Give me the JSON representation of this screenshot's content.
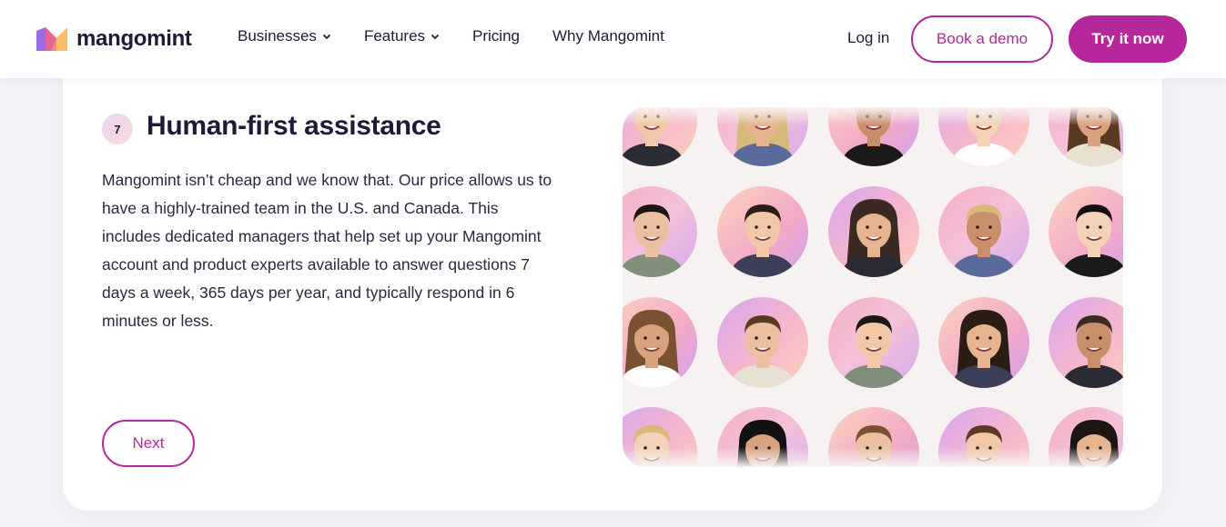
{
  "brand": {
    "name": "mangomint",
    "logo_icon": "mangomint-logo-icon",
    "accent_color": "#b5279a"
  },
  "nav": {
    "items": [
      {
        "label": "Businesses",
        "has_dropdown": true
      },
      {
        "label": "Features",
        "has_dropdown": true
      },
      {
        "label": "Pricing",
        "has_dropdown": false
      },
      {
        "label": "Why Mangomint",
        "has_dropdown": false
      }
    ],
    "login": "Log in",
    "demo": "Book a demo",
    "try": "Try it now"
  },
  "section": {
    "step": "7",
    "title": "Human-first assistance",
    "description": "Mangomint isn’t cheap and we know that. Our price allows us to have a highly-trained team in the U.S. and Canada. This includes dedicated managers that help set up your Mangomint account and product experts available to answer questions 7 days a week, 365 days per year, and typically respond in 6 minutes or less.",
    "next_label": "Next"
  },
  "photos": {
    "rows": 4,
    "columns": 5,
    "image_description": "grid of circular team member portraits on pink and purple gradient backgrounds"
  }
}
